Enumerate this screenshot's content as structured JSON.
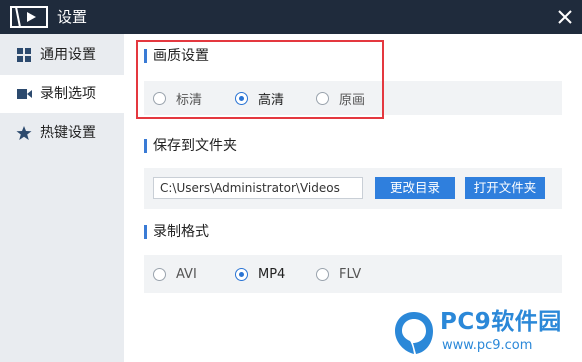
{
  "window": {
    "title": "设置",
    "colors": {
      "titlebar": "#1f2b3c",
      "accent": "#2f7fdd",
      "highlight": "#e4383f"
    }
  },
  "sidebar": {
    "items": [
      {
        "label": "通用设置",
        "icon": "grid-icon",
        "active": false
      },
      {
        "label": "录制选项",
        "icon": "video-camera-icon",
        "active": true
      },
      {
        "label": "热键设置",
        "icon": "star-icon",
        "active": false
      }
    ]
  },
  "quality": {
    "title": "画质设置",
    "options": [
      {
        "label": "标清",
        "checked": false
      },
      {
        "label": "高清",
        "checked": true
      },
      {
        "label": "原画",
        "checked": false
      }
    ]
  },
  "save": {
    "title": "保存到文件夹",
    "path": "C:\\Users\\Administrator\\Videos",
    "change_button": "更改目录",
    "open_button": "打开文件夹"
  },
  "format": {
    "title": "录制格式",
    "options": [
      {
        "label": "AVI",
        "checked": false
      },
      {
        "label": "MP4",
        "checked": true
      },
      {
        "label": "FLV",
        "checked": false
      }
    ]
  },
  "watermark": {
    "title": "PC9软件园",
    "url": "www.pc9.com"
  }
}
